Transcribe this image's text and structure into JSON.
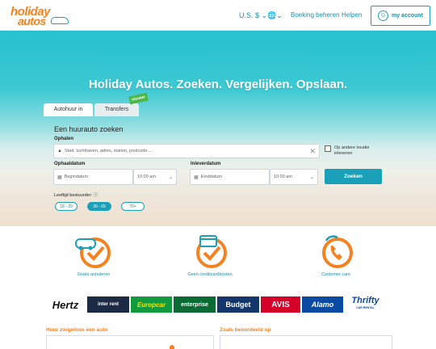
{
  "header": {
    "logo_line1": "holiday",
    "logo_line2": "autos",
    "currency": "U.S. $",
    "globe": "🌐",
    "booking": "Boeking beheren",
    "help": "Helpen",
    "account": "my account"
  },
  "hero": {
    "title": "Holiday Autos. Zoeken. Vergelijken. Opslaan."
  },
  "tabs": {
    "car": "Autohuur in",
    "transfers": "Transfers",
    "new_badge": "nieuwe"
  },
  "form": {
    "title": "Een huurauto zoeken",
    "pickup_label": "Ophalen",
    "pickup_placeholder": "Stad, luchthaven, adres, station, postcode ...",
    "other_location": "Op andere locatie inleveren",
    "pickup_date_label": "Ophaaldatum",
    "return_date_label": "Inleverdatum",
    "pickup_date": "Begindatum",
    "pickup_time": "10:00 am",
    "return_date": "Einddatum",
    "return_time": "10:00 am",
    "search": "Zoeken",
    "age_label": "Leeftijd bestuurder:",
    "ages": [
      "18 - 29",
      "30 - 69",
      "70+"
    ]
  },
  "features": [
    {
      "label": "Gratis annuleren"
    },
    {
      "label": "Geen creditcardkosten"
    },
    {
      "label": "Customer care"
    }
  ],
  "brands": [
    "Hertz",
    "inter rent",
    "Europcar",
    "enterprise",
    "Budget",
    "AVIS",
    "Alamo",
    "Thrifty"
  ],
  "thrifty_sub": "CAR RENTAL",
  "sections": {
    "left": "Huur zorgeloos een auto",
    "right": "Zoals beoordeeld op"
  },
  "colors": {
    "accent": "#f58220",
    "teal": "#1aa0b8"
  }
}
